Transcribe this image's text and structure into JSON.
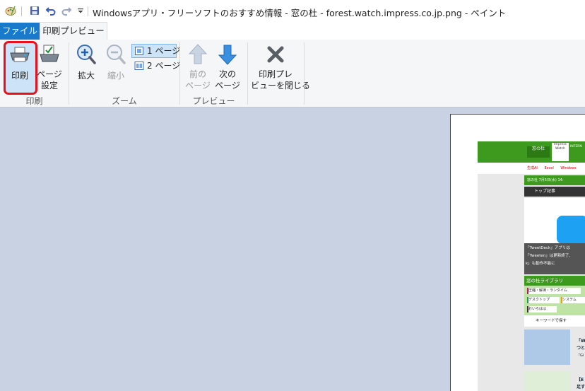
{
  "window": {
    "title": "Windowsアプリ・フリーソフトのおすすめ情報 - 窓の杜 - forest.watch.impress.co.jp.png - ペイント"
  },
  "tabs": [
    {
      "label": "ファイル"
    },
    {
      "label": "印刷プレビュー"
    }
  ],
  "ribbon": {
    "groups": {
      "print": {
        "label": "印刷",
        "buttons": {
          "print": "印刷",
          "page_setup_1": "ページ",
          "page_setup_2": "設定"
        }
      },
      "zoom": {
        "label": "ズーム",
        "buttons": {
          "zoom_in": "拡大",
          "zoom_out": "縮小",
          "one_page": "1 ページ",
          "two_page": "2 ページ"
        }
      },
      "preview": {
        "label": "プレビュー",
        "buttons": {
          "prev_1": "前の",
          "prev_2": "ページ",
          "next_1": "次の",
          "next_2": "ページ"
        }
      },
      "close": {
        "buttons": {
          "close_1": "印刷プレ",
          "close_2": "ビューを閉じる"
        }
      }
    }
  },
  "preview_page": {
    "site_logo": "窓の杜",
    "impress_1": "Impress",
    "impress_2": "Watch",
    "internet": "INTERN",
    "nav_links": [
      "生成AI",
      "Excel",
      "Windows"
    ],
    "date_line": "窓の杜 7月5日(水) 14:",
    "top_articles": "トップ記事",
    "article_text_1": "「TweetDeck」アプリは",
    "article_text_2": "「Tweeten」は更新終了,",
    "article_text_3": "k」も動作不能に",
    "library_title": "窓の杜ライブラリ",
    "library_tags": [
      "圧縮・解凍・ランタイム",
      "デスクトップ",
      "システム",
      "おいろはは"
    ],
    "search_label": "キーワードで探す",
    "item_1": "「W",
    "item_2": "つと",
    "item_3": "「Gi",
    "item_4": "【E",
    "item_5": "足す"
  }
}
